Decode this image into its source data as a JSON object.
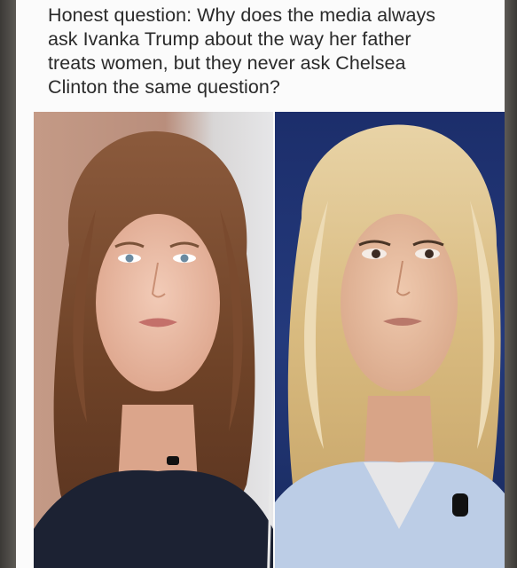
{
  "post": {
    "lines": [
      "Honest question: Why does the media always",
      "ask Ivanka Trump about the way her father",
      "treats women, but they never ask Chelsea",
      "Clinton the same question?"
    ]
  },
  "images": [
    {
      "subject": "woman with wavy auburn-brown hair, navy top"
    },
    {
      "subject": "woman with wavy blonde hair, light blue jacket"
    }
  ],
  "colors": {
    "card_background": "#fbfbfb",
    "text": "#2a2a2a",
    "frame": "#4a4845"
  }
}
